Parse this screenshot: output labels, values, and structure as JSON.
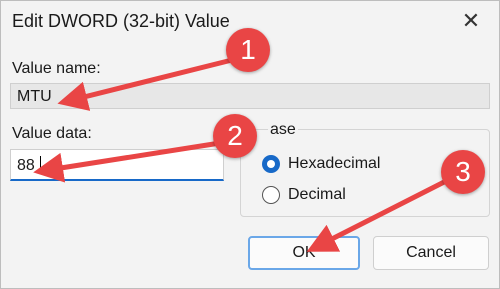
{
  "window": {
    "title": "Edit DWORD (32-bit) Value",
    "close_icon": "close-icon"
  },
  "value_name": {
    "label": "Value name:",
    "value": "MTU"
  },
  "value_data": {
    "label": "Value data:",
    "value": "88"
  },
  "base": {
    "label": "Base",
    "visible_label": "ase",
    "options": [
      {
        "label": "Hexadecimal",
        "selected": true
      },
      {
        "label": "Decimal",
        "selected": false
      }
    ]
  },
  "buttons": {
    "ok": "OK",
    "cancel": "Cancel"
  },
  "annotations": {
    "badge1": "1",
    "badge2": "2",
    "badge3": "3",
    "color": "#e94545"
  },
  "colors": {
    "accent": "#1769c8",
    "background": "#f3f3f3"
  }
}
